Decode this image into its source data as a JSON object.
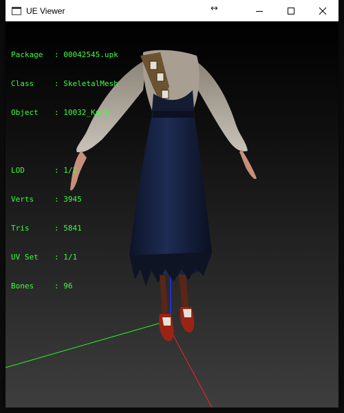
{
  "window": {
    "title": "UE Viewer",
    "icon": "app-window-icon",
    "controls": [
      "minimize-icon",
      "maximize-icon",
      "close-icon"
    ]
  },
  "info": {
    "package_label": "Package",
    "package_value": "00042545.upk",
    "class_label": "Class",
    "class_value": "SkeletalMesh",
    "object_label": "Object",
    "object_value": "10032_KunN",
    "lod_label": "LOD",
    "lod_value": "1/2",
    "verts_label": "Verts",
    "verts_value": "3945",
    "tris_label": "Tris",
    "tris_value": "5841",
    "uvset_label": "UV Set",
    "uvset_value": "1/1",
    "bones_label": "Bones",
    "bones_value": "96"
  },
  "colors": {
    "info_text": "#3cff3c",
    "axis_x": "#ff2020",
    "axis_y": "#20ff20",
    "axis_z": "#2030ff"
  }
}
